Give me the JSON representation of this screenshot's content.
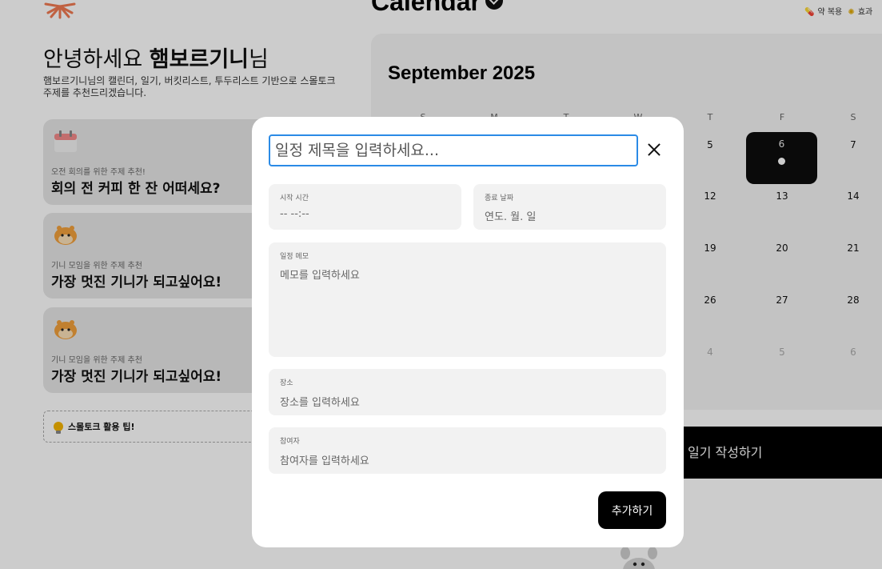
{
  "app": {
    "title": "Calendar"
  },
  "legend": {
    "item1": "약 복용",
    "item2": "효과"
  },
  "greeting": {
    "prefix": "안녕하세요 ",
    "name": "햄보르기니",
    "suffix": "님",
    "subtext": "햄보르기니님의 캘린더, 일기, 버킷리스트, 투두리스트 기반으로 스몰토크 주제를 추천드리겠습니다."
  },
  "cards": [
    {
      "caption": "오전 회의를 위한 주제 추천!",
      "title": "회의 전 커피 한 잔 어떠세요?",
      "icon": "calendar-icon"
    },
    {
      "caption": "기니 모임을 위한 주제 추천",
      "title": "가장 멋진 기니가 되고싶어요!",
      "icon": "hamster-icon"
    },
    {
      "caption": "기니 모임을 위한 주제 추천",
      "title": "가장 멋진 기니가 되고싶어요!",
      "icon": "hamster-icon"
    }
  ],
  "tip": {
    "label": "스몰토크 활용 팁!"
  },
  "calendar": {
    "month": "September 2025",
    "weekdays": [
      "S",
      "M",
      "T",
      "W",
      "T",
      "F",
      "S"
    ],
    "visible_days": [
      [
        "5",
        "6",
        "7"
      ],
      [
        "12",
        "13",
        "14"
      ],
      [
        "19",
        "20",
        "21"
      ],
      [
        "26",
        "27",
        "28"
      ],
      [
        "4",
        "5",
        "6"
      ]
    ],
    "selected_day": "6"
  },
  "diary_button": "일기 작성하기",
  "modal": {
    "title_placeholder": "일정 제목을 입력하세요...",
    "start": {
      "label": "시작 시간",
      "value": "-- --:--"
    },
    "end": {
      "label": "종료 날짜",
      "value": "연도. 월. 일"
    },
    "memo": {
      "label": "일정 메모",
      "placeholder": "메모를 입력하세요"
    },
    "place": {
      "label": "장소",
      "placeholder": "장소를 입력하세요"
    },
    "people": {
      "label": "참여자",
      "placeholder": "참여자를 입력하세요"
    },
    "submit": "추가하기"
  },
  "colors": {
    "accent": "#2b8be6",
    "primary": "#000000",
    "overlay": "rgba(0,0,0,0.2)"
  }
}
